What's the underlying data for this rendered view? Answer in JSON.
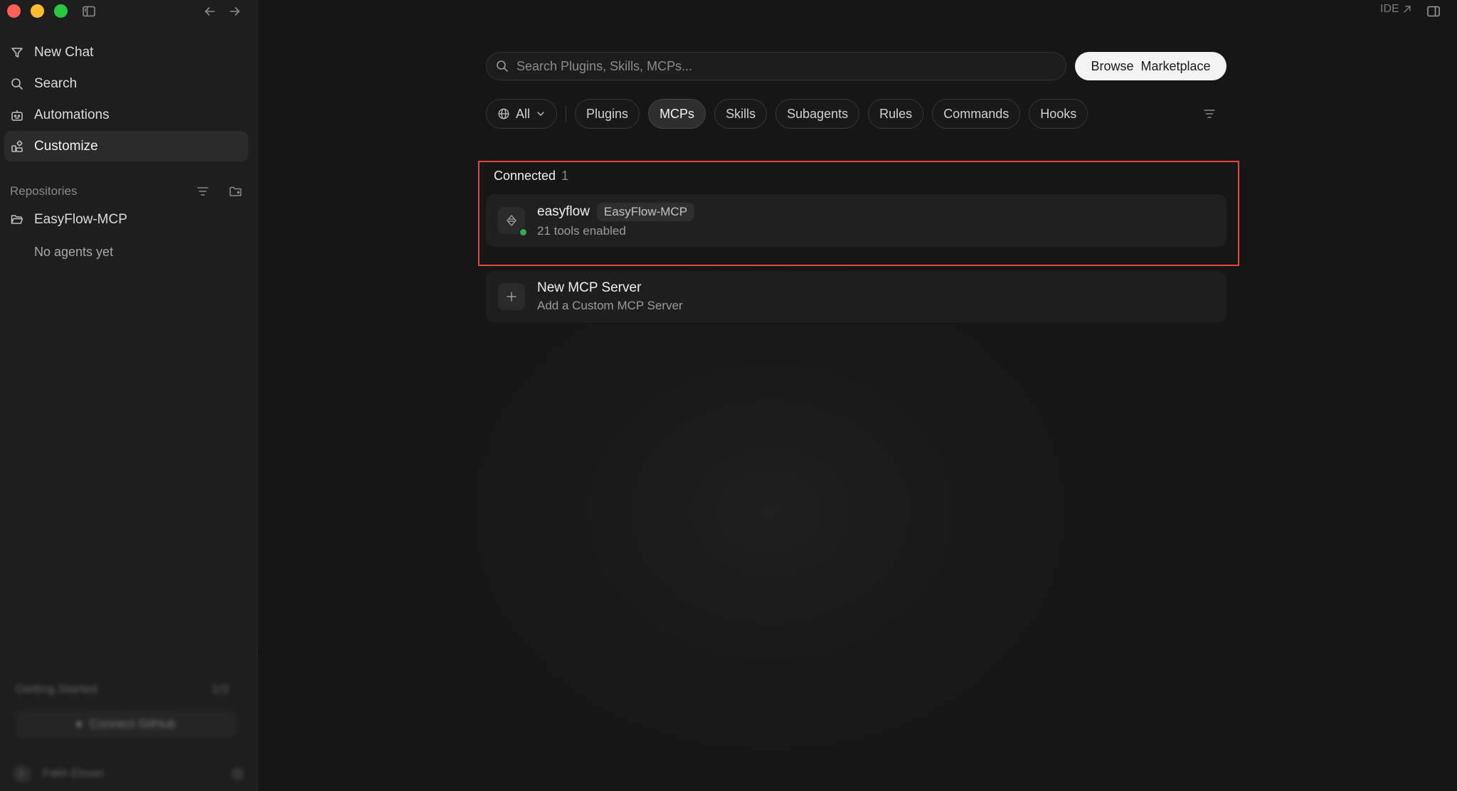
{
  "sidebar": {
    "nav": [
      {
        "label": "New Chat",
        "icon": "new-chat-icon"
      },
      {
        "label": "Search",
        "icon": "search-icon"
      },
      {
        "label": "Automations",
        "icon": "automations-icon"
      },
      {
        "label": "Customize",
        "icon": "customize-icon",
        "active": true
      }
    ],
    "repositories_label": "Repositories",
    "repo": {
      "name": "EasyFlow-MCP",
      "empty_text": "No agents yet"
    },
    "bottom": {
      "getting_started": "Getting Started",
      "getting_started_count": "1/3",
      "connect_github": "Connect GitHub",
      "user_initial": "F",
      "user_name": "Fakh Ehsan"
    }
  },
  "topbar": {
    "ide_label": "IDE"
  },
  "search": {
    "placeholder": "Search Plugins, Skills, MCPs..."
  },
  "browse_button": "Browse  Marketplace",
  "filters": [
    {
      "label": "All",
      "type": "dropdown"
    },
    {
      "label": "Plugins"
    },
    {
      "label": "MCPs",
      "active": true
    },
    {
      "label": "Skills"
    },
    {
      "label": "Subagents"
    },
    {
      "label": "Rules"
    },
    {
      "label": "Commands"
    },
    {
      "label": "Hooks"
    }
  ],
  "connected": {
    "title": "Connected",
    "count": "1",
    "server": {
      "name": "easyflow",
      "tag": "EasyFlow-MCP",
      "status": "21 tools enabled",
      "status_color": "#3aa957"
    }
  },
  "new_server": {
    "title": "New MCP Server",
    "subtitle": "Add a Custom MCP Server"
  },
  "colors": {
    "highlight": "#e2463f",
    "accent_dot": "#3aa957",
    "browse_bg": "#f3f3f3"
  }
}
